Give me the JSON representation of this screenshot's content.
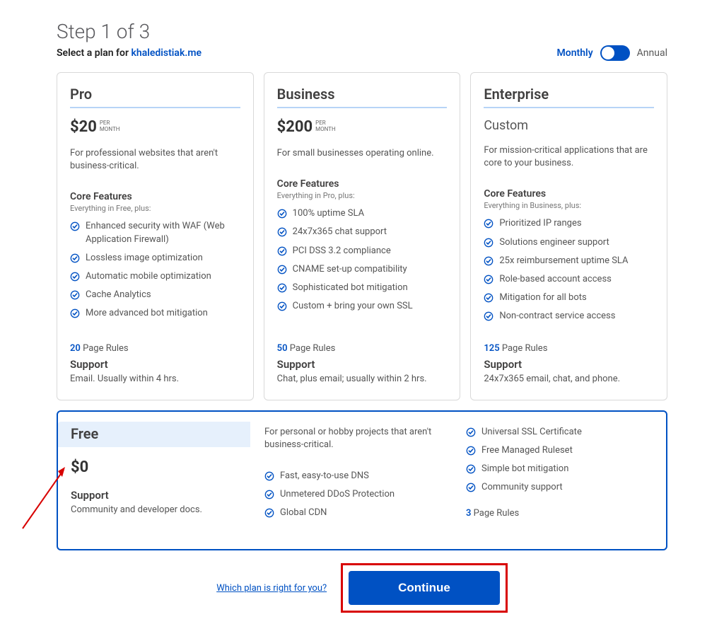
{
  "header": {
    "step": "Step 1 of 3",
    "subtitle_prefix": "Select a plan for ",
    "domain": "khaledistiak.me",
    "billing_monthly": "Monthly",
    "billing_annual": "Annual"
  },
  "plans": [
    {
      "name": "Pro",
      "price": "$20",
      "per": "PER",
      "month": "MONTH",
      "desc": "For professional websites that aren't business-critical.",
      "core_title": "Core Features",
      "core_sub": "Everything in Free, plus:",
      "features": [
        "Enhanced security with WAF (Web Application Firewall)",
        "Lossless image optimization",
        "Automatic mobile optimization",
        "Cache Analytics",
        "More advanced bot mitigation"
      ],
      "rules_count": "20",
      "rules_label": " Page Rules",
      "support_title": "Support",
      "support_desc": "Email. Usually within 4 hrs."
    },
    {
      "name": "Business",
      "price": "$200",
      "per": "PER",
      "month": "MONTH",
      "desc": "For small businesses operating online.",
      "core_title": "Core Features",
      "core_sub": "Everything in Pro, plus:",
      "features": [
        "100% uptime SLA",
        "24x7x365 chat support",
        "PCI DSS 3.2 compliance",
        "CNAME set-up compatibility",
        "Sophisticated bot mitigation",
        "Custom + bring your own SSL"
      ],
      "rules_count": "50",
      "rules_label": " Page Rules",
      "support_title": "Support",
      "support_desc": "Chat, plus email; usually within 2 hrs."
    },
    {
      "name": "Enterprise",
      "custom_label": "Custom",
      "desc": "For mission-critical applications that are core to your business.",
      "core_title": "Core Features",
      "core_sub": "Everything in Business, plus:",
      "features": [
        "Prioritized IP ranges",
        "Solutions engineer support",
        "25x reimbursement uptime SLA",
        "Role-based account access",
        "Mitigation for all bots",
        "Non-contract service access"
      ],
      "rules_count": "125",
      "rules_label": " Page Rules",
      "support_title": "Support",
      "support_desc": "24x7x365 email, chat, and phone."
    }
  ],
  "free": {
    "name": "Free",
    "price": "$0",
    "support_title": "Support",
    "support_desc": "Community and developer docs.",
    "desc": "For personal or hobby projects that aren't business-critical.",
    "col1_features": [
      "Fast, easy-to-use DNS",
      "Unmetered DDoS Protection",
      "Global CDN"
    ],
    "col2_features": [
      "Universal SSL Certificate",
      "Free Managed Ruleset",
      "Simple bot mitigation",
      "Community support"
    ],
    "rules_count": "3",
    "rules_label": " Page Rules"
  },
  "footer": {
    "help_link": "Which plan is right for you?",
    "continue": "Continue"
  }
}
